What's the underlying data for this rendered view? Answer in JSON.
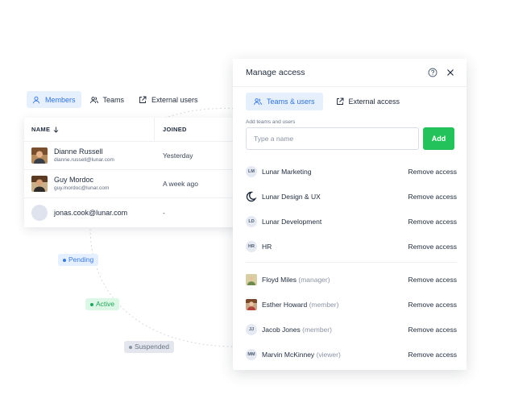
{
  "status_pills": {
    "pending": "Pending",
    "active": "Active",
    "suspended": "Suspended"
  },
  "member_tabs": [
    {
      "label": "Members",
      "icon": "user-icon",
      "active": true
    },
    {
      "label": "Teams",
      "icon": "users-icon",
      "active": false
    },
    {
      "label": "External users",
      "icon": "external-link-icon",
      "active": false
    }
  ],
  "members_table": {
    "columns": [
      "NAME",
      "JOINED"
    ],
    "rows": [
      {
        "name": "Dianne Russell",
        "email": "dianne.russell@lunar.com",
        "joined": "Yesterday"
      },
      {
        "name": "Guy Mordoc",
        "email": "guy.mordoc@lunar.com",
        "joined": "A week ago"
      },
      {
        "name": "",
        "email": "jonas.cook@lunar.com",
        "joined": "-"
      }
    ]
  },
  "panel": {
    "title": "Manage access",
    "tabs": [
      {
        "label": "Teams & users",
        "active": true
      },
      {
        "label": "External access",
        "active": false
      }
    ],
    "add_label": "Add teams and users",
    "input_placeholder": "Type a name",
    "add_button": "Add",
    "remove_label": "Remove access",
    "teams": [
      {
        "initials": "LM",
        "name": "Lunar Marketing"
      },
      {
        "initials": "",
        "name": "Lunar Design & UX"
      },
      {
        "initials": "LD",
        "name": "Lunar Development"
      },
      {
        "initials": "HR",
        "name": "HR"
      }
    ],
    "users": [
      {
        "initials": "",
        "name": "Floyd Miles",
        "role": "(manager)"
      },
      {
        "initials": "",
        "name": "Esther Howard",
        "role": "(member)"
      },
      {
        "initials": "JJ",
        "name": "Jacob Jones",
        "role": "(member)"
      },
      {
        "initials": "MM",
        "name": "Marvin McKinney",
        "role": "(viewer)"
      }
    ]
  },
  "colors": {
    "accent": "#2f72d4",
    "add_button": "#23c25a",
    "pending": "#3b7ad9",
    "active": "#22a55b",
    "suspended": "#6b7587"
  }
}
